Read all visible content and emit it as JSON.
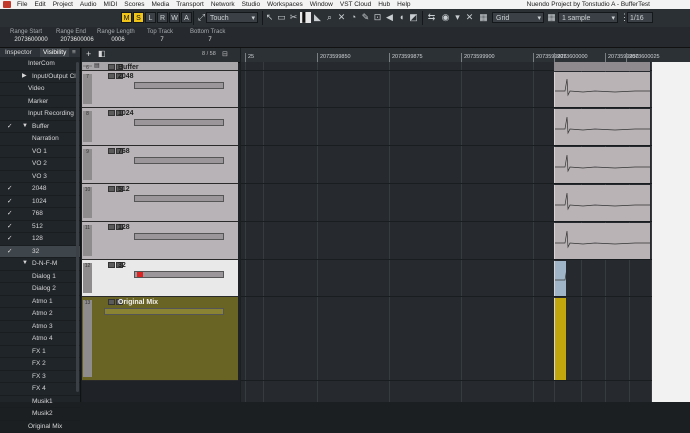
{
  "window": {
    "title": "Nuendo Project by Tonstudio A - BufferTest",
    "menu": [
      "File",
      "Edit",
      "Project",
      "Audio",
      "MIDI",
      "Scores",
      "Media",
      "Transport",
      "Network",
      "Studio",
      "Workspaces",
      "Window",
      "VST Cloud",
      "Hub",
      "Help"
    ]
  },
  "toolbar": {
    "buttons": [
      "M",
      "S",
      "L",
      "R",
      "W",
      "A"
    ],
    "automation_mode": "Touch",
    "grid_type": "Grid",
    "quantize": "1 sample",
    "quantize_value": "1/16"
  },
  "infoline": {
    "range_start": {
      "label": "Range Start",
      "value": "2073600000"
    },
    "range_end": {
      "label": "Range End",
      "value": "2073600006"
    },
    "range_length": {
      "label": "Range Length",
      "value": "0006"
    },
    "top_track": {
      "label": "Top Track",
      "value": "7"
    },
    "bottom_track": {
      "label": "Bottom Track",
      "value": "7"
    }
  },
  "inspector": {
    "tab_inspector": "Inspector",
    "tab_visibility": "Visibility",
    "items": [
      {
        "label": "InterCom",
        "checked": false,
        "indent": 1
      },
      {
        "label": "Input/Output Cl",
        "checked": false,
        "indent": 2,
        "arrow": "right"
      },
      {
        "label": "Video",
        "checked": false,
        "indent": 1
      },
      {
        "label": "Marker",
        "checked": false,
        "indent": 1
      },
      {
        "label": "Input Recording",
        "checked": false,
        "indent": 1
      },
      {
        "label": "Buffer",
        "checked": true,
        "indent": 2,
        "arrow": "down"
      },
      {
        "label": "Narration",
        "checked": false,
        "indent": 2
      },
      {
        "label": "VO 1",
        "checked": false,
        "indent": 2
      },
      {
        "label": "VO 2",
        "checked": false,
        "indent": 2
      },
      {
        "label": "VO 3",
        "checked": false,
        "indent": 2
      },
      {
        "label": "2048",
        "checked": true,
        "indent": 2
      },
      {
        "label": "1024",
        "checked": true,
        "indent": 2
      },
      {
        "label": "768",
        "checked": true,
        "indent": 2
      },
      {
        "label": "512",
        "checked": true,
        "indent": 2
      },
      {
        "label": "128",
        "checked": true,
        "indent": 2
      },
      {
        "label": "32",
        "checked": true,
        "indent": 2,
        "selected": true
      },
      {
        "label": "D-N-F-M",
        "checked": false,
        "indent": 2,
        "arrow": "down"
      },
      {
        "label": "Dialog 1",
        "checked": false,
        "indent": 2
      },
      {
        "label": "Dialog 2",
        "checked": false,
        "indent": 2
      },
      {
        "label": "Atmo 1",
        "checked": false,
        "indent": 2
      },
      {
        "label": "Atmo 2",
        "checked": false,
        "indent": 2
      },
      {
        "label": "Atmo 3",
        "checked": false,
        "indent": 2
      },
      {
        "label": "Atmo 4",
        "checked": false,
        "indent": 2
      },
      {
        "label": "FX 1",
        "checked": false,
        "indent": 2
      },
      {
        "label": "FX 2",
        "checked": false,
        "indent": 2
      },
      {
        "label": "FX 3",
        "checked": false,
        "indent": 2
      },
      {
        "label": "FX 4",
        "checked": false,
        "indent": 2
      },
      {
        "label": "Musik1",
        "checked": false,
        "indent": 2
      },
      {
        "label": "Musik2",
        "checked": false,
        "indent": 2
      },
      {
        "label": "Original Mix",
        "checked": false,
        "indent": 1
      }
    ]
  },
  "tracklist": {
    "track_count": "8 / 58",
    "tracks": [
      {
        "num": "6",
        "name": "Buffer",
        "kind": "folder"
      },
      {
        "num": "7",
        "name": "2048",
        "kind": "audio"
      },
      {
        "num": "8",
        "name": "1024",
        "kind": "audio"
      },
      {
        "num": "9",
        "name": "768",
        "kind": "audio"
      },
      {
        "num": "10",
        "name": "512",
        "kind": "audio"
      },
      {
        "num": "11",
        "name": "128",
        "kind": "audio"
      },
      {
        "num": "12",
        "name": "32",
        "kind": "audio",
        "selected": true
      },
      {
        "num": "13",
        "name": "Original Mix",
        "kind": "audio-olive"
      }
    ]
  },
  "ruler": {
    "labels": [
      "25",
      "2073599850",
      "2073599875",
      "2073599900",
      "2073599925",
      "2073599950",
      "2073599975",
      "2073600000",
      "2073600025",
      "2073600050"
    ]
  },
  "colors": {
    "event_fill": "#b9b3b6",
    "olive": "#6a6424",
    "olive_event": "#c2a60e",
    "selected_track": "#e9e9e9"
  }
}
